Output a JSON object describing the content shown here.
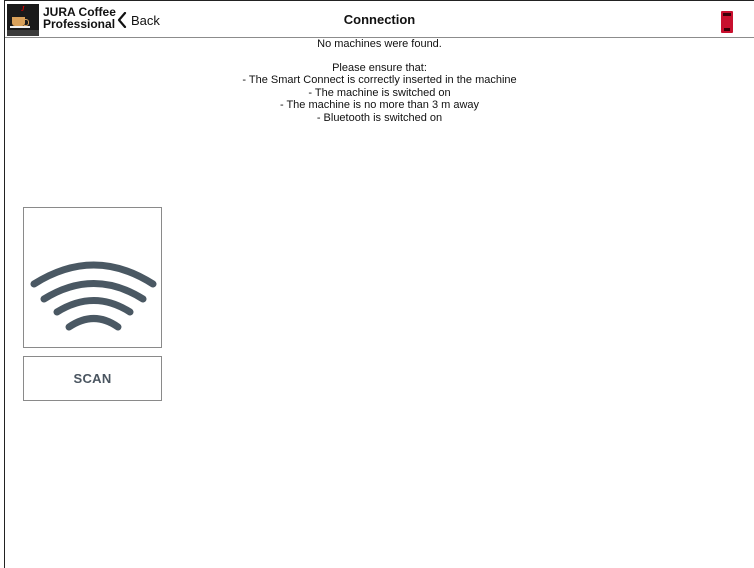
{
  "header": {
    "app_title_line1": "JURA Coffee",
    "app_title_line2": "Professional",
    "back_label": "Back",
    "page_title": "Connection"
  },
  "messages": {
    "status": "No machines were found.",
    "intro": "Please ensure that:",
    "checklist": [
      "- The Smart Connect is correctly inserted in the machine",
      "- The machine is switched on",
      "- The machine is no more than 3 m away",
      "- Bluetooth is switched on"
    ]
  },
  "scan": {
    "button_label": "SCAN"
  },
  "icons": {
    "app": "jura-app-icon",
    "back": "chevron-left-icon",
    "device": "smart-connect-device-icon",
    "scan": "wireless-signal-icon"
  },
  "colors": {
    "signal_arcs": "#4a5863",
    "device_icon": "#c8102e",
    "scan_label": "#4a5560"
  }
}
